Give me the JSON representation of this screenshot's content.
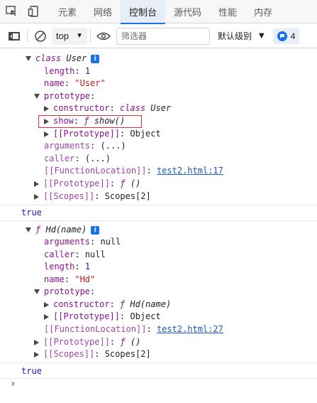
{
  "tabs": [
    "元素",
    "网络",
    "控制台",
    "源代码",
    "性能",
    "内存"
  ],
  "active_tab": "控制台",
  "toolbar": {
    "context": "top",
    "filter_placeholder": "筛选器",
    "levels_label": "默认级别",
    "issues_count": "4"
  },
  "group1": {
    "header_kw": "class",
    "header_name": "User",
    "length_key": "length",
    "length_val": "1",
    "name_key": "name",
    "name_val": "\"User\"",
    "prototype_key": "prototype",
    "constructor_key": "constructor",
    "constructor_kw": "class",
    "constructor_name": "User",
    "show_key": "show",
    "show_f": "ƒ",
    "show_val": "show()",
    "proto_key": "[[Prototype]]",
    "proto_val": "Object",
    "arguments_key": "arguments",
    "arguments_val": "(...)",
    "caller_key": "caller",
    "caller_val": "(...)",
    "fnloc_key": "[[FunctionLocation]]",
    "fnloc_val": "test2.html:17",
    "proto2_key": "[[Prototype]]",
    "proto2_f": "ƒ",
    "proto2_val": "()",
    "scopes_key": "[[Scopes]]",
    "scopes_val": "Scopes[2]"
  },
  "result1": "true",
  "group2": {
    "header_f": "ƒ",
    "header_name": "Hd(name)",
    "arguments_key": "arguments",
    "arguments_val": "null",
    "caller_key": "caller",
    "caller_val": "null",
    "length_key": "length",
    "length_val": "1",
    "name_key": "name",
    "name_val": "\"Hd\"",
    "prototype_key": "prototype",
    "constructor_key": "constructor",
    "constructor_f": "ƒ",
    "constructor_name": "Hd(name)",
    "proto_key": "[[Prototype]]",
    "proto_val": "Object",
    "fnloc_key": "[[FunctionLocation]]",
    "fnloc_val": "test2.html:27",
    "proto2_key": "[[Prototype]]",
    "proto2_f": "ƒ",
    "proto2_val": "()",
    "scopes_key": "[[Scopes]]",
    "scopes_val": "Scopes[2]"
  },
  "result2": "true",
  "prompt_symbol": "›"
}
